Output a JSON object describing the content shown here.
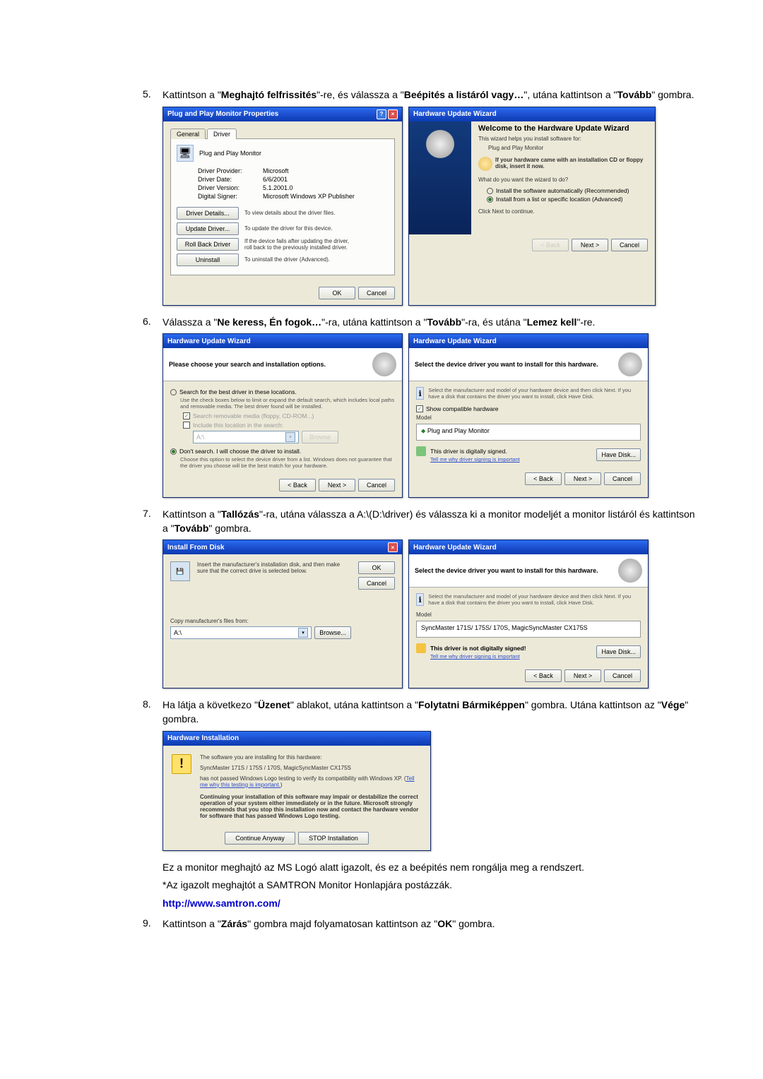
{
  "steps": {
    "s5": {
      "text_a": "Kattintson a \"",
      "bold_a": "Meghajtó felfrissités",
      "text_b": "\"-re, és válassza a \"",
      "bold_b": "Beépités a listáról vagy…",
      "text_c": "\", utána kattintson a \"",
      "bold_c": "Tovább",
      "text_d": "\" gombra."
    },
    "s6": {
      "text_a": "Válassza a \"",
      "bold_a": "Ne keress, Én fogok…",
      "text_b": "\"-ra, utána kattintson a \"",
      "bold_b": "Tovább",
      "text_c": "\"-ra, és utána \"",
      "bold_c": "Lemez kell",
      "text_d": "\"-re."
    },
    "s7": {
      "text_a": "Kattintson a \"",
      "bold_a": "Tallózás",
      "text_b": "\"-ra, utána válassza a A:\\(D:\\driver) és válassza ki a monitor modeljét a monitor listáról és kattintson a \"",
      "bold_b": "Tovább",
      "text_c": "\" gombra."
    },
    "s8": {
      "text_a": "Ha látja a következo \"",
      "bold_a": "Üzenet",
      "text_b": "\" ablakot, utána kattintson a \"",
      "bold_b": "Folytatni Bármiképpen",
      "text_c": "\" gombra. Utána kattintson az \"",
      "bold_c": "Vége",
      "text_d": "\" gombra."
    },
    "s8_note1": "Ez a monitor meghajtó az MS Logó alatt igazolt, és ez a beépités nem rongálja meg a rendszert.",
    "s8_note2": "*Az igazolt meghajtót a SAMTRON Monitor Honlapjára postázzák.",
    "s8_link": "http://www.samtron.com/",
    "s9": {
      "text_a": "Kattintson a \"",
      "bold_a": "Zárás",
      "text_b": "\" gombra majd folyamatosan kattintson az \"",
      "bold_b": "OK",
      "text_c": "\" gombra."
    }
  },
  "props": {
    "title": "Plug and Play Monitor Properties",
    "tab_general": "General",
    "tab_driver": "Driver",
    "monitor": "Plug and Play Monitor",
    "k_provider": "Driver Provider:",
    "v_provider": "Microsoft",
    "k_date": "Driver Date:",
    "v_date": "6/6/2001",
    "k_version": "Driver Version:",
    "v_version": "5.1.2001.0",
    "k_signer": "Digital Signer:",
    "v_signer": "Microsoft Windows XP Publisher",
    "btn_details": "Driver Details...",
    "btn_details_desc": "To view details about the driver files.",
    "btn_update": "Update Driver...",
    "btn_update_desc": "To update the driver for this device.",
    "btn_roll": "Roll Back Driver",
    "btn_roll_desc": "If the device fails after updating the driver, roll back to the previously installed driver.",
    "btn_uninst": "Uninstall",
    "btn_uninst_desc": "To uninstall the driver (Advanced).",
    "ok": "OK",
    "cancel": "Cancel"
  },
  "wiz1": {
    "title": "Hardware Update Wizard",
    "head": "Welcome to the Hardware Update Wizard",
    "intro": "This wizard helps you install software for:",
    "device": "Plug and Play Monitor",
    "cdnote": "If your hardware came with an installation CD or floppy disk, insert it now.",
    "q": "What do you want the wizard to do?",
    "opt1": "Install the software automatically (Recommended)",
    "opt2": "Install from a list or specific location (Advanced)",
    "cont": "Click Next to continue.",
    "back": "< Back",
    "next": "Next >",
    "cancel": "Cancel"
  },
  "wiz2": {
    "title": "Hardware Update Wizard",
    "head": "Please choose your search and installation options.",
    "opt_search": "Search for the best driver in these locations.",
    "opt_search_desc": "Use the check boxes below to limit or expand the default search, which includes local paths and removable media. The best driver found will be installed.",
    "chk_media": "Search removable media (floppy, CD-ROM...)",
    "chk_include": "Include this location in the search:",
    "path": "A:\\",
    "browse": "Browse",
    "opt_dont": "Don't search. I will choose the driver to install.",
    "opt_dont_desc": "Choose this option to select the device driver from a list. Windows does not guarantee that the driver you choose will be the best match for your hardware.",
    "back": "< Back",
    "next": "Next >",
    "cancel": "Cancel"
  },
  "wiz3": {
    "title": "Hardware Update Wizard",
    "head": "Select the device driver you want to install for this hardware.",
    "desc": "Select the manufacturer and model of your hardware device and then click Next. If you have a disk that contains the driver you want to install, click Have Disk.",
    "chk_compat": "Show compatible hardware",
    "model_label": "Model",
    "model_val": "Plug and Play Monitor",
    "sign_ok": "This driver is digitally signed.",
    "sign_why": "Tell me why driver signing is important",
    "have_disk": "Have Disk...",
    "back": "< Back",
    "next": "Next >",
    "cancel": "Cancel"
  },
  "ifd": {
    "title": "Install From Disk",
    "text": "Insert the manufacturer's installation disk, and then make sure that the correct drive is selected below.",
    "ok": "OK",
    "cancel": "Cancel",
    "copy": "Copy manufacturer's files from:",
    "path": "A:\\",
    "browse": "Browse..."
  },
  "wiz4": {
    "title": "Hardware Update Wizard",
    "head": "Select the device driver you want to install for this hardware.",
    "desc": "Select the manufacturer and model of your hardware device and then click Next. If you have a disk that contains the driver you want to install, click Have Disk.",
    "model_label": "Model",
    "model_val": "SyncMaster 171S/ 175S/ 170S, MagicSyncMaster CX175S",
    "sign_warn": "This driver is not digitally signed!",
    "sign_why": "Tell me why driver signing is important",
    "have_disk": "Have Disk...",
    "back": "< Back",
    "next": "Next >",
    "cancel": "Cancel"
  },
  "hwinst": {
    "title": "Hardware Installation",
    "line1": "The software you are installing for this hardware:",
    "device": "SyncMaster 171S / 175S / 170S, MagicSyncMaster CX175S",
    "line2a": "has not passed Windows Logo testing to verify its compatibility with Windows XP. (",
    "line2_link": "Tell me why this testing is important.",
    "line2b": ")",
    "bold": "Continuing your installation of this software may impair or destabilize the correct operation of your system either immediately or in the future. Microsoft strongly recommends that you stop this installation now and contact the hardware vendor for software that has passed Windows Logo testing.",
    "btn_cont": "Continue Anyway",
    "btn_stop": "STOP Installation"
  }
}
